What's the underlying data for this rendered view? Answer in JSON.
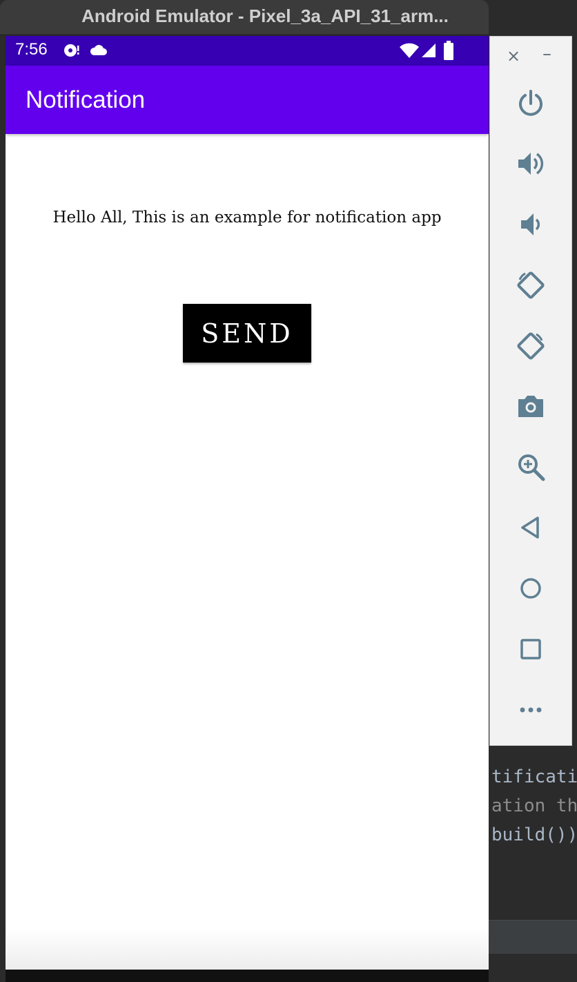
{
  "window": {
    "title": "Android Emulator - Pixel_3a_API_31_arm..."
  },
  "status_bar": {
    "time": "7:56",
    "icons": [
      "media-icon",
      "cloud-icon",
      "wifi-icon",
      "signal-icon",
      "battery-icon"
    ]
  },
  "app": {
    "title": "Notification",
    "message": "Hello All, This is an example for notification app",
    "send_label": "SEND",
    "colors": {
      "status_bar": "#3700b3",
      "app_bar": "#6200ee",
      "button": "#000000"
    }
  },
  "toolbar": {
    "close": "×",
    "minimize": "–",
    "buttons": [
      "power-icon",
      "volume-up-icon",
      "volume-down-icon",
      "rotate-left-icon",
      "rotate-right-icon",
      "camera-icon",
      "zoom-icon",
      "back-icon",
      "home-icon",
      "overview-icon",
      "more-icon"
    ]
  },
  "ide": {
    "lines": [
      "tificatio",
      "ation tha",
      "build())"
    ]
  }
}
